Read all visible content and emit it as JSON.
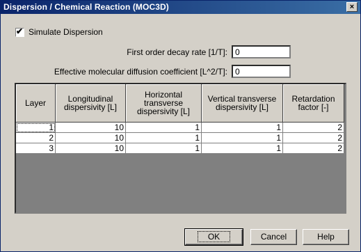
{
  "window": {
    "title": "Dispersion / Chemical Reaction (MOC3D)",
    "close_glyph": "×"
  },
  "simulate": {
    "label": "Simulate Dispersion",
    "checked_glyph": "✔"
  },
  "decay": {
    "label": "First order decay rate [1/T]:",
    "value": "0"
  },
  "diffusion": {
    "label": "Effective molecular diffusion coefficient [L^2/T]:",
    "value": "0"
  },
  "table": {
    "headers": [
      "Layer",
      "Longitudinal dispersivity [L]",
      "Horizontal transverse dispersivity [L]",
      "Vertical transverse dispersivity [L]",
      "Retardation factor [-]"
    ],
    "rows": [
      [
        "1",
        "10",
        "1",
        "1",
        "2"
      ],
      [
        "2",
        "10",
        "1",
        "1",
        "2"
      ],
      [
        "3",
        "10",
        "1",
        "1",
        "2"
      ]
    ]
  },
  "buttons": {
    "ok": "OK",
    "cancel": "Cancel",
    "help": "Help"
  }
}
